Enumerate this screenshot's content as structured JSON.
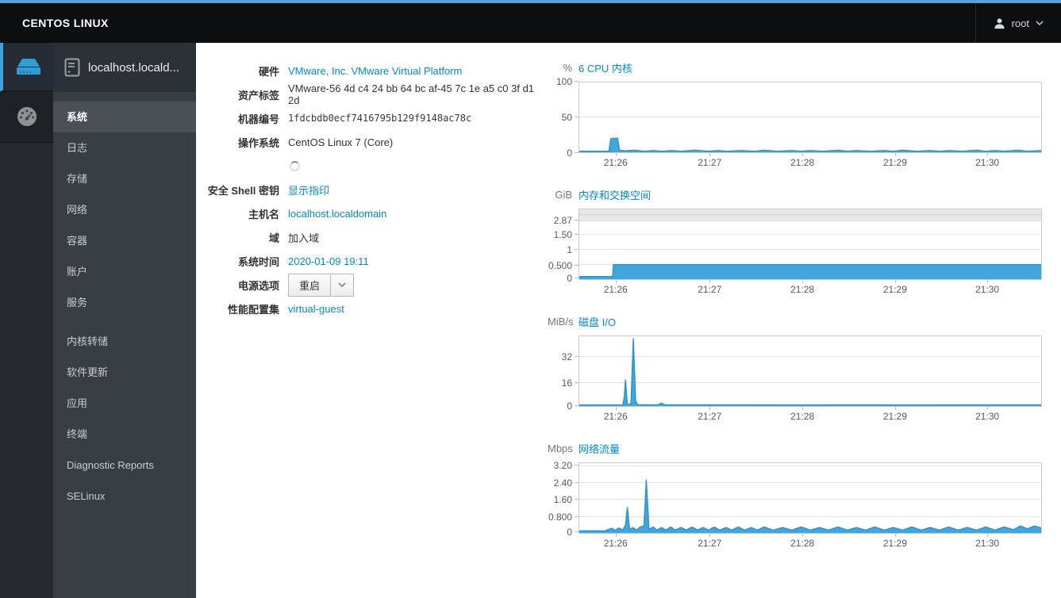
{
  "topbar": {
    "brand": "CENTOS LINUX",
    "user": "root"
  },
  "sidebar": {
    "host_label": "localhost.locald...",
    "items": [
      {
        "label": "系统",
        "name": "system",
        "selected": true
      },
      {
        "label": "日志",
        "name": "logs"
      },
      {
        "label": "存储",
        "name": "storage"
      },
      {
        "label": "网络",
        "name": "networking"
      },
      {
        "label": "容器",
        "name": "containers"
      },
      {
        "label": "账户",
        "name": "accounts"
      },
      {
        "label": "服务",
        "name": "services"
      },
      {
        "label": "内核转储",
        "name": "kdump",
        "group_start": true
      },
      {
        "label": "软件更新",
        "name": "software-updates"
      },
      {
        "label": "应用",
        "name": "applications"
      },
      {
        "label": "终端",
        "name": "terminal"
      },
      {
        "label": "Diagnostic Reports",
        "name": "diagnostic-reports"
      },
      {
        "label": "SELinux",
        "name": "selinux"
      }
    ]
  },
  "system": {
    "rows": [
      {
        "name": "hardware",
        "label": "硬件",
        "value": "VMware, Inc. VMware Virtual Platform",
        "type": "link"
      },
      {
        "name": "asset-tag",
        "label": "资产标签",
        "value": "VMware-56 4d c4 24 bb 64 bc af-45 7c 1e a5 c0 3f d1 2d",
        "type": "text"
      },
      {
        "name": "machine-id",
        "label": "机器编号",
        "value": "1fdcbdb0ecf7416795b129f9148ac78c",
        "type": "mono"
      },
      {
        "name": "operating-system",
        "label": "操作系统",
        "value": "CentOS Linux 7 (Core)",
        "type": "text"
      },
      {
        "name": "loading",
        "label": "",
        "value": "",
        "type": "spinner"
      },
      {
        "name": "ssh-keys",
        "label": "安全 Shell 密钥",
        "value": "显示指印",
        "type": "link"
      },
      {
        "name": "hostname",
        "label": "主机名",
        "value": "localhost.localdomain",
        "type": "link"
      },
      {
        "name": "domain",
        "label": "域",
        "value": "加入域",
        "type": "action"
      },
      {
        "name": "system-time",
        "label": "系统时间",
        "value": "2020-01-09 19:11",
        "type": "link"
      },
      {
        "name": "power-options",
        "label": "电源选项",
        "value": "重启",
        "type": "button"
      },
      {
        "name": "performance-profile",
        "label": "性能配置集",
        "value": "virtual-guest",
        "type": "link"
      }
    ]
  },
  "chart_data": [
    {
      "id": "cpu",
      "type": "area",
      "unit": "%",
      "title": "6 CPU 内核",
      "ylabel": "%",
      "ylim": [
        0,
        100
      ],
      "y_top_value": 100,
      "grid": true,
      "legend_position": "none",
      "color": "#43a5db",
      "line_color": "#2c94cc",
      "y_ticks": [
        {
          "label": "100",
          "value": 100,
          "frac": 1
        },
        {
          "label": "50",
          "value": 50,
          "frac": 0.5
        },
        {
          "label": "0",
          "value": 0,
          "frac": 0
        }
      ],
      "x_ticks": [
        {
          "label": "21:26",
          "frac": 0.08
        },
        {
          "label": "21:27",
          "frac": 0.283
        },
        {
          "label": "21:28",
          "frac": 0.483
        },
        {
          "label": "21:29",
          "frac": 0.683
        },
        {
          "label": "21:30",
          "frac": 0.882
        }
      ],
      "points": [
        [
          0,
          1.5
        ],
        [
          0.064,
          1.5
        ],
        [
          0.068,
          19
        ],
        [
          0.071,
          20
        ],
        [
          0.083,
          20
        ],
        [
          0.087,
          3
        ],
        [
          0.1,
          2
        ],
        [
          0.12,
          3
        ],
        [
          0.14,
          1.5
        ],
        [
          0.16,
          2.5
        ],
        [
          0.18,
          1.5
        ],
        [
          0.2,
          2.5
        ],
        [
          0.22,
          1.5
        ],
        [
          0.25,
          3
        ],
        [
          0.28,
          1.5
        ],
        [
          0.3,
          2.5
        ],
        [
          0.32,
          1.5
        ],
        [
          0.35,
          2.5
        ],
        [
          0.38,
          1.5
        ],
        [
          0.4,
          3
        ],
        [
          0.43,
          1.5
        ],
        [
          0.46,
          2.5
        ],
        [
          0.48,
          1.5
        ],
        [
          0.5,
          2.5
        ],
        [
          0.53,
          1.5
        ],
        [
          0.56,
          3
        ],
        [
          0.58,
          1.5
        ],
        [
          0.6,
          2.5
        ],
        [
          0.63,
          1.5
        ],
        [
          0.66,
          2.5
        ],
        [
          0.68,
          1.5
        ],
        [
          0.7,
          3
        ],
        [
          0.73,
          1.5
        ],
        [
          0.76,
          2.5
        ],
        [
          0.78,
          1.5
        ],
        [
          0.8,
          2.5
        ],
        [
          0.83,
          1.5
        ],
        [
          0.86,
          3
        ],
        [
          0.88,
          1.5
        ],
        [
          0.9,
          2.5
        ],
        [
          0.92,
          1.5
        ],
        [
          0.95,
          3
        ],
        [
          0.97,
          1.5
        ],
        [
          1,
          2.5
        ]
      ]
    },
    {
      "id": "memory",
      "type": "area",
      "unit": "GiB",
      "title": "内存和交换空间",
      "ylabel": "GiB",
      "ylim": [
        0,
        3.2
      ],
      "y_top_value": 3.2,
      "grid": true,
      "legend_position": "none",
      "color": "#43a5db",
      "line_color": "#2c94cc",
      "swap_band": {
        "from_value": 2.87
      },
      "y_ticks": [
        {
          "label": "2.87",
          "value": 2.87,
          "frac": 0.833
        },
        {
          "label": "1.50",
          "value": 1.5,
          "frac": 0.633
        },
        {
          "label": "1",
          "value": 1,
          "frac": 0.422
        },
        {
          "label": "0.500",
          "value": 0.5,
          "frac": 0.2
        },
        {
          "label": "0",
          "value": 0,
          "frac": 0.02
        }
      ],
      "x_ticks": [
        {
          "label": "21:26",
          "frac": 0.08
        },
        {
          "label": "21:27",
          "frac": 0.283
        },
        {
          "label": "21:28",
          "frac": 0.483
        },
        {
          "label": "21:29",
          "frac": 0.683
        },
        {
          "label": "21:30",
          "frac": 0.882
        }
      ],
      "points": [
        [
          0,
          0.05
        ],
        [
          0.072,
          0.05
        ],
        [
          0.074,
          0.52
        ],
        [
          1,
          0.52
        ]
      ]
    },
    {
      "id": "disk-io",
      "type": "area",
      "unit": "MiB/s",
      "title": "磁盘 I/O",
      "ylabel": "MiB/s",
      "ylim": [
        0,
        43
      ],
      "y_top_value": 43,
      "grid": true,
      "legend_position": "none",
      "color": "#43a5db",
      "line_color": "#2c94cc",
      "y_ticks": [
        {
          "label": "32",
          "value": 32,
          "frac": 0.7
        },
        {
          "label": "16",
          "value": 16,
          "frac": 0.333
        },
        {
          "label": "0",
          "value": 0,
          "frac": 0.01
        }
      ],
      "x_ticks": [
        {
          "label": "21:26",
          "frac": 0.08
        },
        {
          "label": "21:27",
          "frac": 0.283
        },
        {
          "label": "21:28",
          "frac": 0.483
        },
        {
          "label": "21:29",
          "frac": 0.683
        },
        {
          "label": "21:30",
          "frac": 0.882
        }
      ],
      "points": [
        [
          0,
          0.3
        ],
        [
          0.094,
          0.3
        ],
        [
          0.097,
          5
        ],
        [
          0.1,
          18
        ],
        [
          0.104,
          1
        ],
        [
          0.108,
          0.4
        ],
        [
          0.112,
          2
        ],
        [
          0.117,
          42
        ],
        [
          0.122,
          3
        ],
        [
          0.127,
          0.4
        ],
        [
          0.17,
          0.4
        ],
        [
          0.178,
          1.6
        ],
        [
          0.185,
          0.4
        ],
        [
          0.3,
          0.4
        ],
        [
          0.45,
          0.3
        ],
        [
          0.6,
          0.4
        ],
        [
          0.75,
          0.3
        ],
        [
          0.9,
          0.4
        ],
        [
          1,
          0.4
        ]
      ]
    },
    {
      "id": "network",
      "type": "area",
      "unit": "Mbps",
      "title": "网络流量",
      "ylabel": "Mbps",
      "ylim": [
        0,
        3.35
      ],
      "y_top_value": 3.35,
      "grid": true,
      "legend_position": "none",
      "color": "#43a5db",
      "line_color": "#2c94cc",
      "y_ticks": [
        {
          "label": "3.20",
          "value": 3.2,
          "frac": 0.956
        },
        {
          "label": "2.40",
          "value": 2.4,
          "frac": 0.711
        },
        {
          "label": "1.60",
          "value": 1.6,
          "frac": 0.478
        },
        {
          "label": "0.800",
          "value": 0.8,
          "frac": 0.233
        },
        {
          "label": "0",
          "value": 0,
          "frac": 0.02
        }
      ],
      "x_ticks": [
        {
          "label": "21:26",
          "frac": 0.08
        },
        {
          "label": "21:27",
          "frac": 0.283
        },
        {
          "label": "21:28",
          "frac": 0.483
        },
        {
          "label": "21:29",
          "frac": 0.683
        },
        {
          "label": "21:30",
          "frac": 0.882
        }
      ],
      "points": [
        [
          0,
          0.04
        ],
        [
          0.055,
          0.04
        ],
        [
          0.07,
          0.18
        ],
        [
          0.078,
          0.07
        ],
        [
          0.086,
          0.2
        ],
        [
          0.094,
          0.08
        ],
        [
          0.1,
          0.35
        ],
        [
          0.104,
          1.25
        ],
        [
          0.109,
          0.1
        ],
        [
          0.116,
          0.22
        ],
        [
          0.124,
          0.08
        ],
        [
          0.132,
          0.25
        ],
        [
          0.14,
          0.3
        ],
        [
          0.145,
          2.58
        ],
        [
          0.151,
          0.12
        ],
        [
          0.16,
          0.25
        ],
        [
          0.168,
          0.08
        ],
        [
          0.178,
          0.22
        ],
        [
          0.188,
          0.08
        ],
        [
          0.198,
          0.25
        ],
        [
          0.208,
          0.08
        ],
        [
          0.22,
          0.22
        ],
        [
          0.232,
          0.08
        ],
        [
          0.244,
          0.25
        ],
        [
          0.256,
          0.08
        ],
        [
          0.268,
          0.22
        ],
        [
          0.28,
          0.08
        ],
        [
          0.292,
          0.25
        ],
        [
          0.304,
          0.08
        ],
        [
          0.318,
          0.22
        ],
        [
          0.33,
          0.08
        ],
        [
          0.344,
          0.25
        ],
        [
          0.358,
          0.08
        ],
        [
          0.372,
          0.22
        ],
        [
          0.386,
          0.08
        ],
        [
          0.4,
          0.25
        ],
        [
          0.42,
          0.08
        ],
        [
          0.44,
          0.22
        ],
        [
          0.46,
          0.08
        ],
        [
          0.48,
          0.25
        ],
        [
          0.5,
          0.08
        ],
        [
          0.52,
          0.22
        ],
        [
          0.54,
          0.08
        ],
        [
          0.56,
          0.25
        ],
        [
          0.58,
          0.08
        ],
        [
          0.6,
          0.22
        ],
        [
          0.62,
          0.08
        ],
        [
          0.64,
          0.25
        ],
        [
          0.66,
          0.08
        ],
        [
          0.68,
          0.22
        ],
        [
          0.7,
          0.08
        ],
        [
          0.72,
          0.25
        ],
        [
          0.74,
          0.08
        ],
        [
          0.76,
          0.22
        ],
        [
          0.78,
          0.08
        ],
        [
          0.8,
          0.25
        ],
        [
          0.82,
          0.08
        ],
        [
          0.84,
          0.22
        ],
        [
          0.86,
          0.08
        ],
        [
          0.88,
          0.25
        ],
        [
          0.9,
          0.08
        ],
        [
          0.92,
          0.25
        ],
        [
          0.94,
          0.1
        ],
        [
          0.955,
          0.3
        ],
        [
          0.97,
          0.15
        ],
        [
          0.985,
          0.3
        ],
        [
          1,
          0.2
        ]
      ]
    }
  ]
}
